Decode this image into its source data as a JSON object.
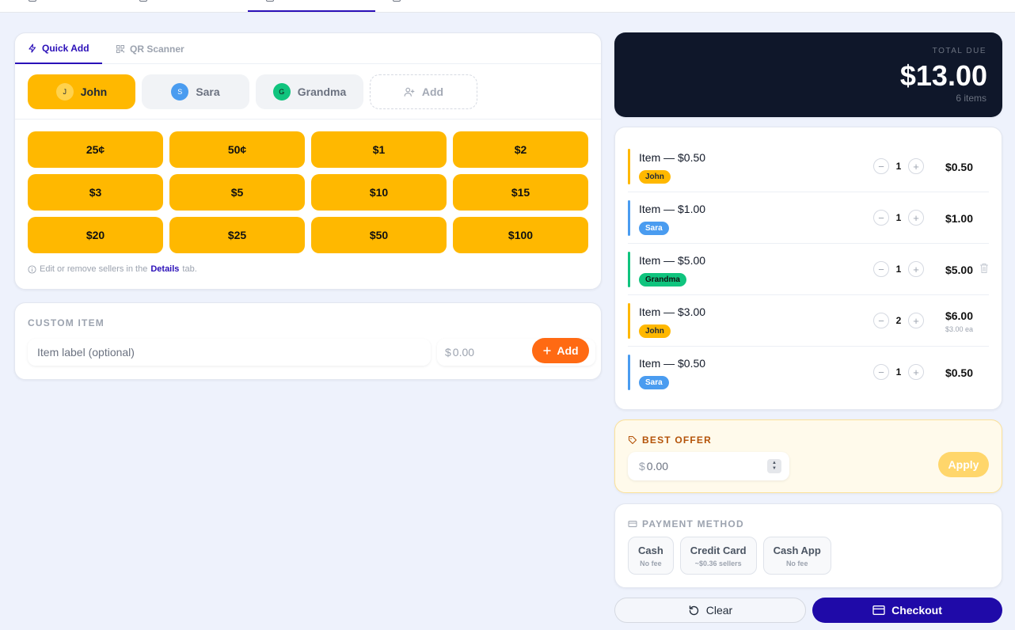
{
  "tabs": {
    "quick_add": "Quick Add",
    "qr_scanner": "QR Scanner"
  },
  "sellers": [
    {
      "initial": "J",
      "name": "John",
      "color": "#ffb800",
      "selected": true
    },
    {
      "initial": "S",
      "name": "Sara",
      "color": "#4a9cf0",
      "selected": false
    },
    {
      "initial": "G",
      "name": "Grandma",
      "color": "#10c47e",
      "selected": false
    }
  ],
  "add_seller_label": "Add",
  "amounts": [
    "25¢",
    "50¢",
    "$1",
    "$2",
    "$3",
    "$5",
    "$10",
    "$15",
    "$20",
    "$25",
    "$50",
    "$100"
  ],
  "hint": {
    "prefix": "Edit or remove sellers in the",
    "link": "Details",
    "suffix": "tab."
  },
  "custom_item": {
    "title": "CUSTOM ITEM",
    "label_placeholder": "Item label (optional)",
    "currency": "$",
    "price_placeholder": "0.00",
    "add_label": "Add"
  },
  "total": {
    "label": "TOTAL DUE",
    "value": "$13.00",
    "count": "6 items"
  },
  "cart": [
    {
      "name": "Item — $0.50",
      "seller": "John",
      "seller_color": "#ffb800",
      "seller_text": "#1f2937",
      "qty": "1",
      "price": "$0.50",
      "each": ""
    },
    {
      "name": "Item — $1.00",
      "seller": "Sara",
      "seller_color": "#4a9cf0",
      "seller_text": "#ffffff",
      "qty": "1",
      "price": "$1.00",
      "each": ""
    },
    {
      "name": "Item — $5.00",
      "seller": "Grandma",
      "seller_color": "#10c47e",
      "seller_text": "#111111",
      "qty": "1",
      "price": "$5.00",
      "each": ""
    },
    {
      "name": "Item — $3.00",
      "seller": "John",
      "seller_color": "#ffb800",
      "seller_text": "#1f2937",
      "qty": "2",
      "price": "$6.00",
      "each": "$3.00 ea"
    },
    {
      "name": "Item — $0.50",
      "seller": "Sara",
      "seller_color": "#4a9cf0",
      "seller_text": "#ffffff",
      "qty": "1",
      "price": "$0.50",
      "each": ""
    }
  ],
  "best_offer": {
    "title": "BEST OFFER",
    "currency": "$",
    "placeholder": "0.00",
    "apply_label": "Apply"
  },
  "payment": {
    "title": "PAYMENT METHOD",
    "options": [
      {
        "label": "Cash",
        "sub": "No fee"
      },
      {
        "label": "Credit Card",
        "sub": "~$0.36 sellers"
      },
      {
        "label": "Cash App",
        "sub": "No fee"
      }
    ]
  },
  "actions": {
    "clear": "Clear",
    "checkout": "Checkout"
  },
  "colors": {
    "accent": "#2a0fb8",
    "amount_button": "#ffb800",
    "add_button": "#ff6a13",
    "total_bg": "#0f172a"
  }
}
